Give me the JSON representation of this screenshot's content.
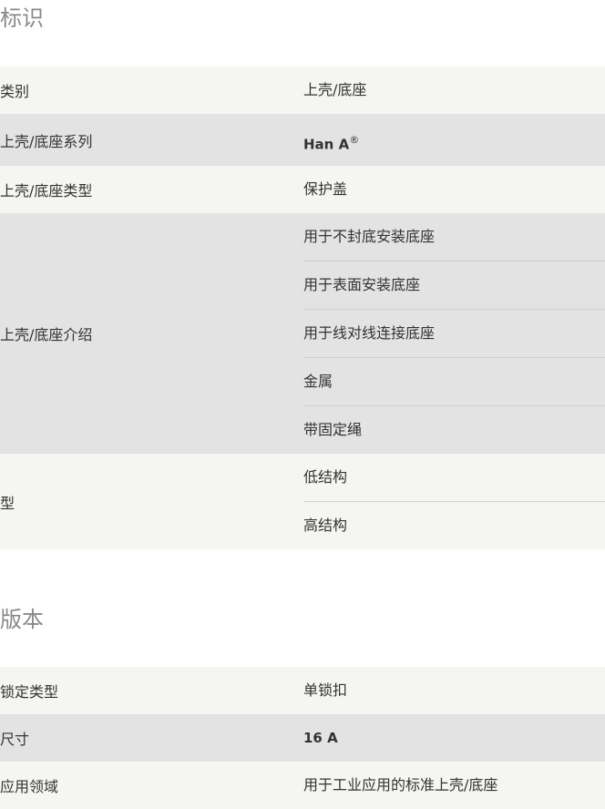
{
  "sections": [
    {
      "title": "标识",
      "rows": [
        {
          "label": "类别",
          "values": [
            "上壳/底座"
          ]
        },
        {
          "label": "上壳/底座系列",
          "values": [
            "Han A"
          ],
          "sup": "®"
        },
        {
          "label": "上壳/底座类型",
          "values": [
            "保护盖"
          ]
        },
        {
          "label": "上壳/底座介绍",
          "values": [
            "用于不封底安装底座",
            "用于表面安装底座",
            "用于线对线连接底座",
            "金属",
            "带固定绳"
          ]
        },
        {
          "label": "型",
          "values": [
            "低结构",
            "高结构"
          ]
        }
      ]
    },
    {
      "title": "版本",
      "rows": [
        {
          "label": "锁定类型",
          "values": [
            "单锁扣"
          ]
        },
        {
          "label": "尺寸",
          "values": [
            "16 A"
          ]
        },
        {
          "label": "应用领域",
          "values": [
            "用于工业应用的标准上壳/底座"
          ]
        }
      ]
    }
  ]
}
